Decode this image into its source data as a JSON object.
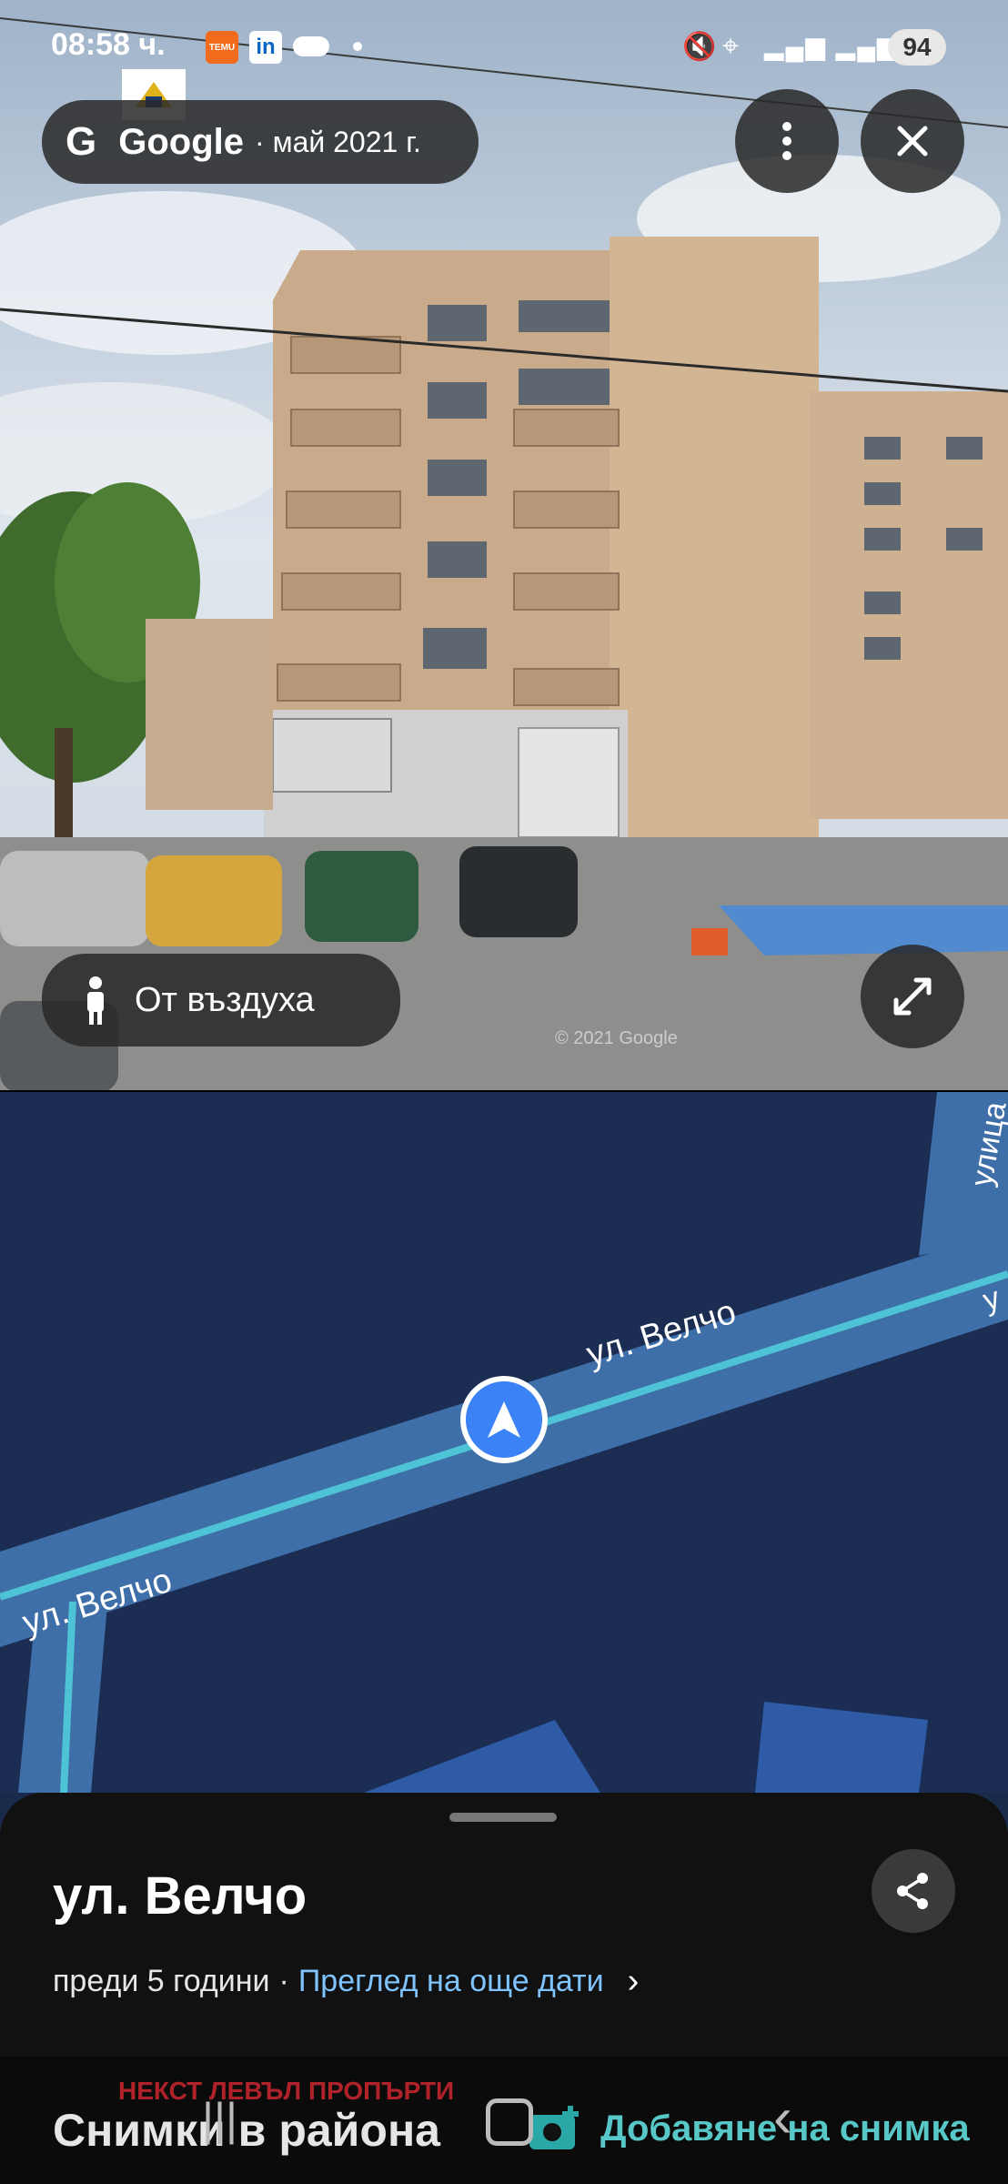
{
  "status_bar": {
    "time": "08:58 ч.",
    "battery": "94",
    "temu_label": "TEMU"
  },
  "header": {
    "brand": "Google",
    "date": "· май 2021 г."
  },
  "watermark": {
    "text": "© 2021 Google"
  },
  "aerial_button": {
    "label": "От въздуха"
  },
  "map": {
    "road_labels": [
      "ул. Велчо",
      "ул. Велчо",
      "улица",
      "у"
    ]
  },
  "sheet": {
    "title": "ул. Велчо",
    "age": "преди 5 години",
    "separator": "·",
    "more_dates": "Преглед на още дати",
    "nearby_photos": "Снимки в района",
    "add_photo": "Добавяне на снимка",
    "overlay_red": "НЕКСТ ЛЕВЪЛ ПРОПЪРТИ"
  },
  "icons": {
    "menu": "more-vert-icon",
    "close": "close-icon",
    "expand": "expand-icon",
    "share": "share-icon",
    "navigation": "navigation-arrow-icon"
  },
  "colors": {
    "link": "#7fc3ff",
    "nav_blue": "#3b82f6",
    "road": "#3f6fa8"
  }
}
